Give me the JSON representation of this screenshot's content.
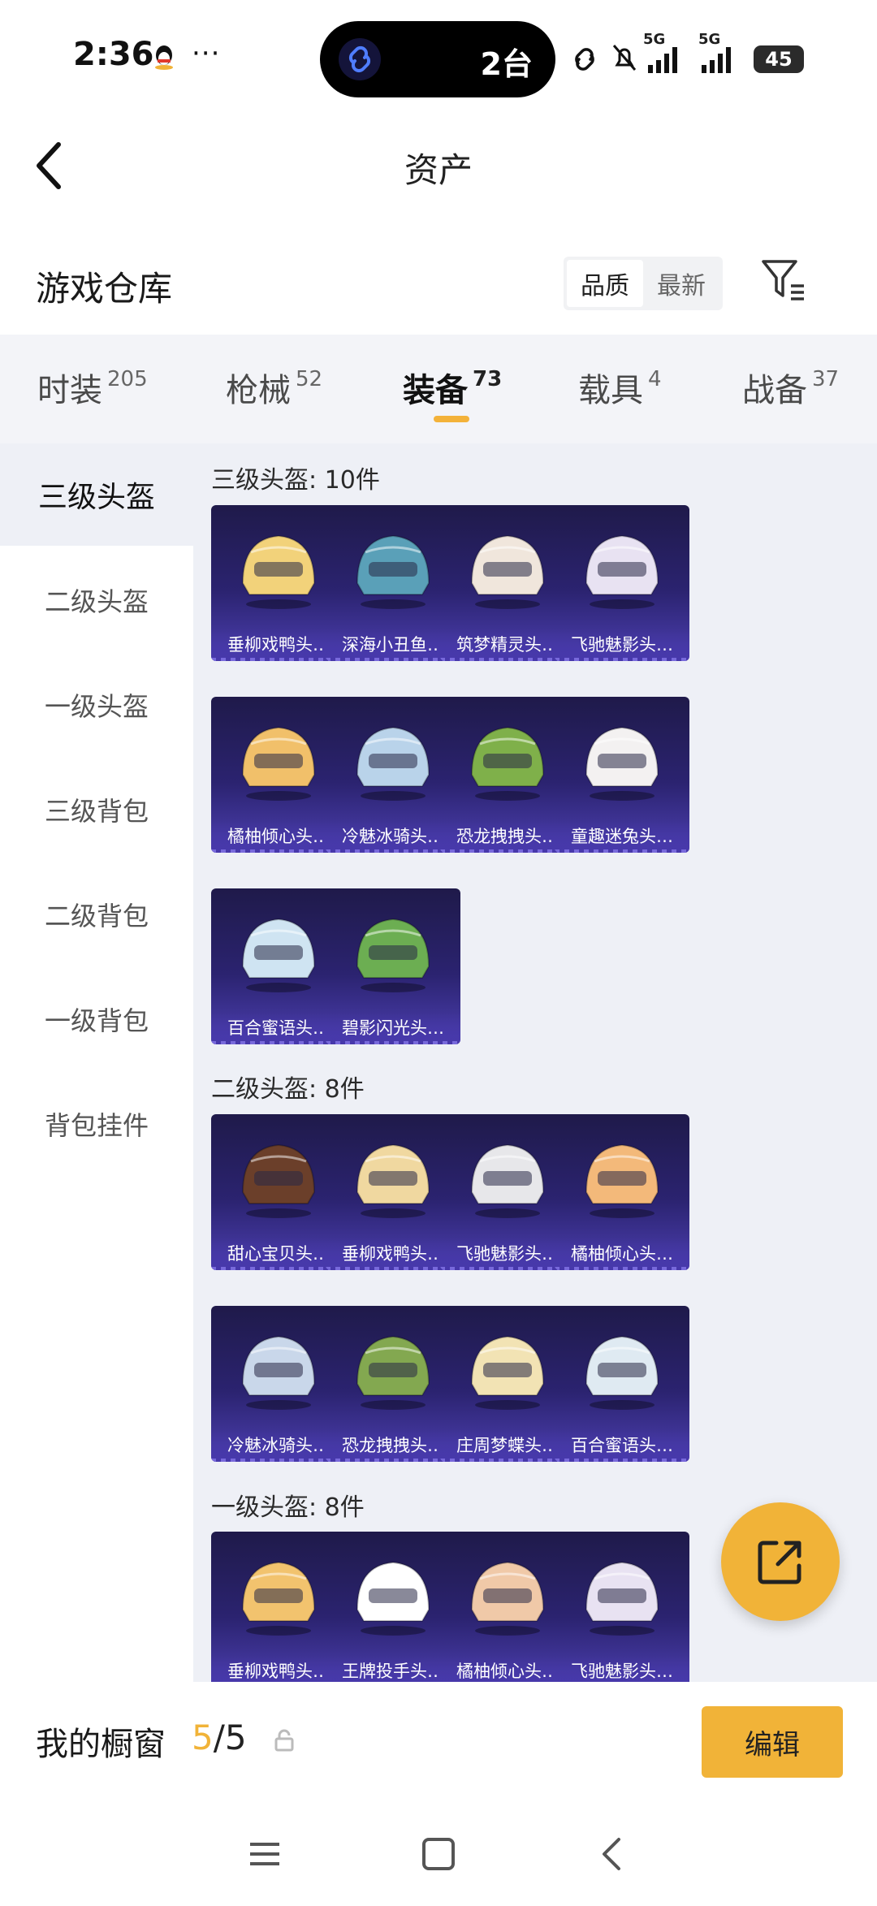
{
  "status_bar": {
    "time": "2:36",
    "more": "···",
    "island_text": "2台",
    "battery": "45",
    "network": [
      "5G",
      "5G"
    ],
    "icons": [
      "qq-icon",
      "link-icon",
      "mute-bell-icon",
      "signal-icon",
      "signal-icon",
      "battery-icon"
    ]
  },
  "header": {
    "title": "资产",
    "back_icon": "back-arrow-icon"
  },
  "warehouse": {
    "title": "游戏仓库",
    "sort_options": [
      "品质",
      "最新"
    ],
    "active_sort": "品质",
    "filter_icon": "filter-icon"
  },
  "tabs": [
    {
      "label": "时装",
      "count": "205"
    },
    {
      "label": "枪械",
      "count": "52"
    },
    {
      "label": "装备",
      "count": "73",
      "active": true
    },
    {
      "label": "载具",
      "count": "4"
    },
    {
      "label": "战备",
      "count": "37"
    }
  ],
  "sidebar": [
    {
      "label": "三级头盔",
      "active": true
    },
    {
      "label": "二级头盔"
    },
    {
      "label": "一级头盔"
    },
    {
      "label": "三级背包"
    },
    {
      "label": "二级背包"
    },
    {
      "label": "一级背包"
    },
    {
      "label": "背包挂件"
    }
  ],
  "sections": [
    {
      "title": "三级头盔: 10件",
      "items": [
        "垂柳戏鸭头…",
        "深海小丑鱼…",
        "筑梦精灵头…",
        "飞驰魅影头…",
        "橘柚倾心头…",
        "冷魅冰骑头…",
        "恐龙拽拽头…",
        "童趣迷兔头…",
        "百合蜜语头…",
        "碧影闪光头…"
      ]
    },
    {
      "title": "二级头盔: 8件",
      "items": [
        "甜心宝贝头…",
        "垂柳戏鸭头…",
        "飞驰魅影头…",
        "橘柚倾心头…",
        "冷魅冰骑头…",
        "恐龙拽拽头…",
        "庄周梦蝶头…",
        "百合蜜语头…"
      ]
    },
    {
      "title": "一级头盔: 8件",
      "items": [
        "垂柳戏鸭头…",
        "王牌投手头…",
        "橘柚倾心头…",
        "飞驰魅影头…"
      ]
    }
  ],
  "bottom_bar": {
    "my_window": "我的橱窗",
    "count_current": "5",
    "count_sep_total": "/5",
    "edit_label": "编辑"
  },
  "colors": {
    "accent": "#f1b338",
    "card_top": "#1f1a4a",
    "card_bottom": "#4c3fb0",
    "panel_bg": "#eef0f6"
  }
}
